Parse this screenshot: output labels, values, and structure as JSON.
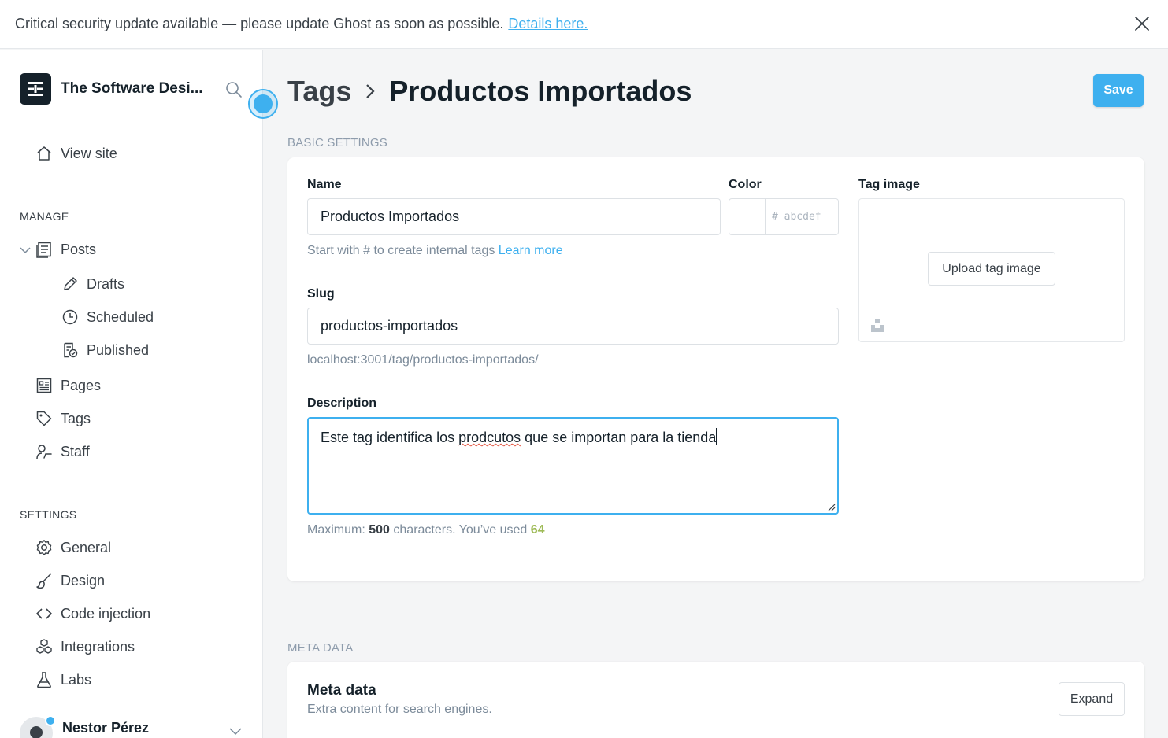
{
  "banner": {
    "message": "Critical security update available — please update Ghost as soon as possible.",
    "link_label": "Details here."
  },
  "sidebar": {
    "site_title": "The Software Desi...",
    "view_site": "View site",
    "manage_heading": "MANAGE",
    "manage_items": [
      {
        "label": "Posts",
        "icon": "posts-icon"
      },
      {
        "label": "Drafts",
        "icon": "pencil-icon"
      },
      {
        "label": "Scheduled",
        "icon": "clock-icon"
      },
      {
        "label": "Published",
        "icon": "published-icon"
      },
      {
        "label": "Pages",
        "icon": "pages-icon"
      },
      {
        "label": "Tags",
        "icon": "tag-icon"
      },
      {
        "label": "Staff",
        "icon": "staff-icon"
      }
    ],
    "settings_heading": "SETTINGS",
    "settings_items": [
      {
        "label": "General",
        "icon": "gear-icon"
      },
      {
        "label": "Design",
        "icon": "brush-icon"
      },
      {
        "label": "Code injection",
        "icon": "code-icon"
      },
      {
        "label": "Integrations",
        "icon": "integrations-icon"
      },
      {
        "label": "Labs",
        "icon": "flask-icon"
      }
    ],
    "user_name": "Nestor Pérez"
  },
  "header": {
    "breadcrumb_parent": "Tags",
    "breadcrumb_current": "Productos Importados",
    "save_label": "Save"
  },
  "basic": {
    "section_title": "BASIC SETTINGS",
    "name_label": "Name",
    "name_value": "Productos Importados",
    "name_hint": "Start with # to create internal tags",
    "learn_more": "Learn more",
    "color_label": "Color",
    "color_placeholder": "# abcdef",
    "tag_image_label": "Tag image",
    "upload_label": "Upload tag image",
    "slug_label": "Slug",
    "slug_value": "productos-importados",
    "slug_url": "localhost:3001/tag/productos-importados/",
    "description_label": "Description",
    "description_before": "Este tag identifica los ",
    "description_misspelled": "prodcutos",
    "description_after": " que se importan para la tienda",
    "max_prefix": "Maximum:",
    "max_value": "500",
    "max_middle": "characters. You’ve used",
    "used_value": "64"
  },
  "meta": {
    "section_title": "META DATA",
    "title": "Meta data",
    "subtitle": "Extra content for search engines.",
    "expand_label": "Expand"
  },
  "colors": {
    "accent": "#3eb0ef",
    "count_green": "#9fbb58"
  }
}
